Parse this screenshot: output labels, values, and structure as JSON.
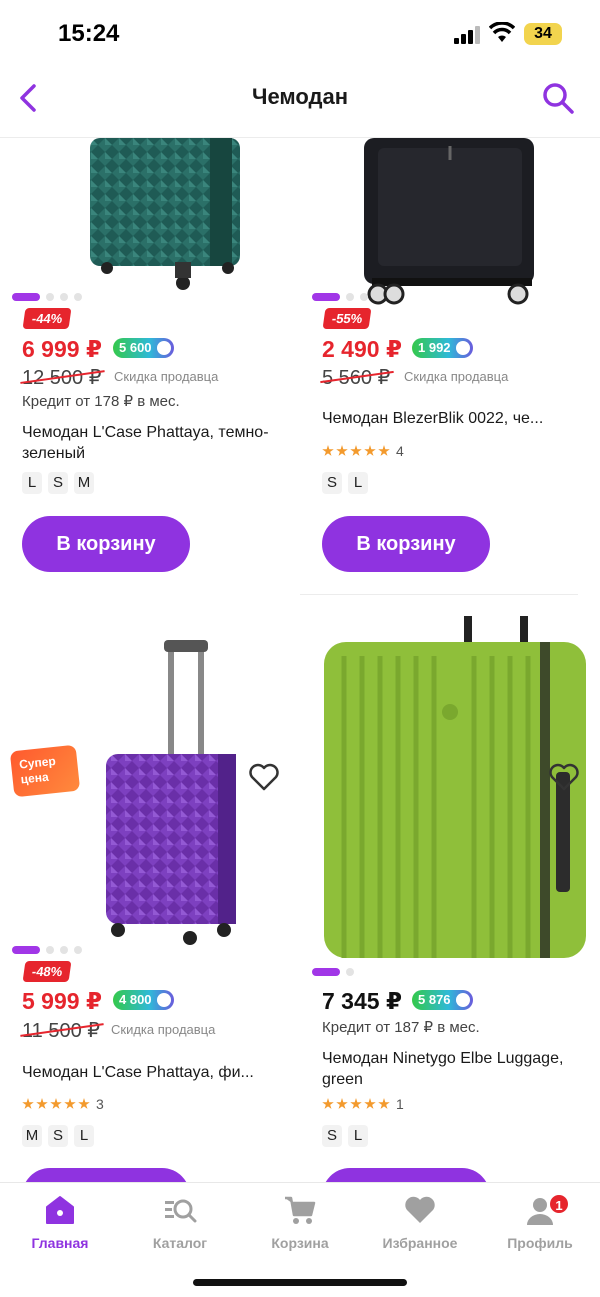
{
  "status_bar": {
    "time": "15:24",
    "battery": "34"
  },
  "header": {
    "title": "Чемодан",
    "back_icon": "chevron-left-icon",
    "search_icon": "search-icon"
  },
  "colors": {
    "accent": "#8f33e0",
    "sale_red": "#e6252d",
    "star": "#f39a2d"
  },
  "products": [
    {
      "image_desc": "dark green diamond-textured suitcase",
      "discount": "-44%",
      "price": "6 999 ₽",
      "bonus": "5 600",
      "old_price": "12 500 ₽",
      "seller_discount": "Скидка продавца",
      "credit": "Кредит от 178 ₽ в мес.",
      "title": "Чемодан L'Case Phattaya, темно-зеленый",
      "sizes": [
        "L",
        "S",
        "M"
      ],
      "cart_label": "В корзину"
    },
    {
      "image_desc": "black fabric suitcase",
      "discount": "-55%",
      "price": "2 490 ₽",
      "bonus": "1 992",
      "old_price": "5 560 ₽",
      "seller_discount": "Скидка продавца",
      "title": "Чемодан BlezerBlik 0022, че...",
      "rating_count": "4",
      "sizes": [
        "S",
        "L"
      ],
      "cart_label": "В корзину"
    },
    {
      "image_desc": "purple diamond-textured suitcase",
      "super_price": "Супер цена",
      "discount": "-48%",
      "price": "5 999 ₽",
      "bonus": "4 800",
      "old_price": "11 500 ₽",
      "seller_discount": "Скидка продавца",
      "title": "Чемодан L'Case Phattaya, фи...",
      "rating_count": "3",
      "sizes": [
        "M",
        "S",
        "L"
      ]
    },
    {
      "image_desc": "lime green ribbed suitcase",
      "price": "7 345 ₽",
      "bonus": "5 876",
      "credit": "Кредит от 187 ₽ в мес.",
      "title": "Чемодан Ninetygo Elbe Luggage, green",
      "rating_count": "1",
      "sizes": [
        "S",
        "L"
      ]
    }
  ],
  "nav": [
    {
      "label": "Главная",
      "icon": "home-icon",
      "active": true
    },
    {
      "label": "Каталог",
      "icon": "catalog-search-icon"
    },
    {
      "label": "Корзина",
      "icon": "cart-icon"
    },
    {
      "label": "Избранное",
      "icon": "heart-icon"
    },
    {
      "label": "Профиль",
      "icon": "profile-icon",
      "badge": "1"
    }
  ]
}
